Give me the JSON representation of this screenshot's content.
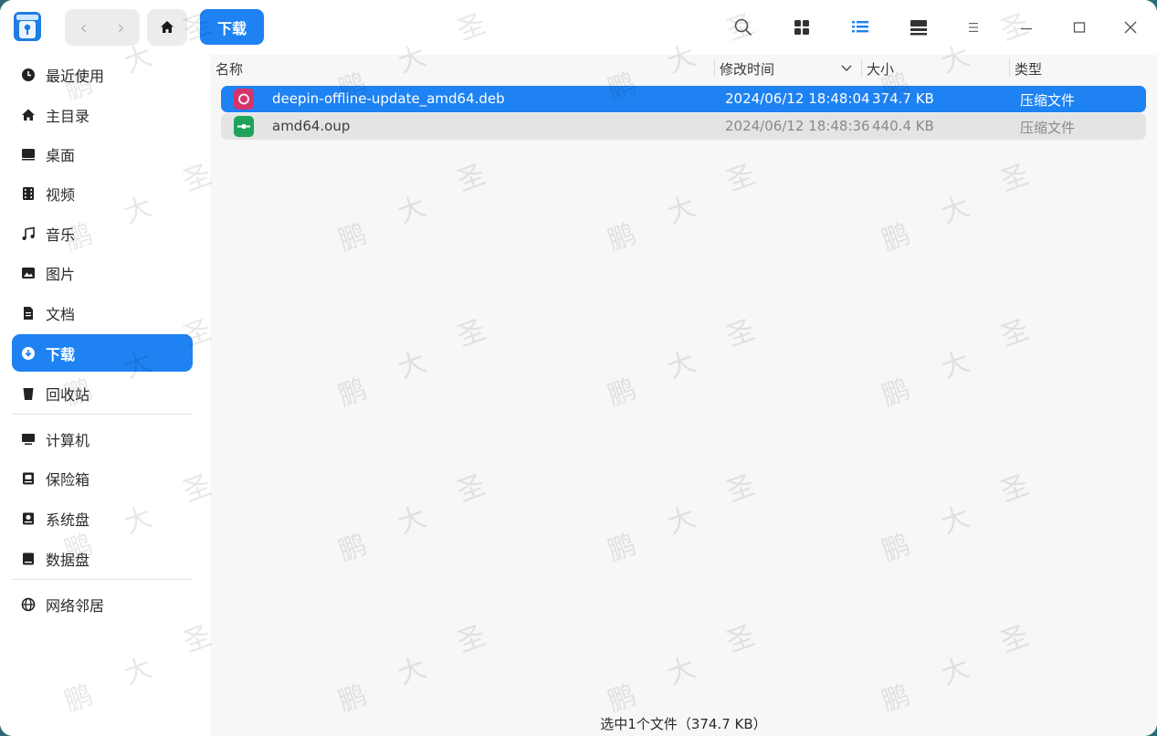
{
  "titlebar": {
    "breadcrumb": "下载",
    "icons": [
      "back-icon",
      "forward-icon",
      "home-icon",
      "search-icon",
      "icon-view-icon",
      "list-view-icon",
      "detail-view-icon",
      "menu-icon",
      "minimize-icon",
      "maximize-icon",
      "close-icon"
    ],
    "accent": "#1e82f2"
  },
  "sidebar": {
    "items": [
      {
        "label": "最近使用",
        "icon": "clock-icon"
      },
      {
        "label": "主目录",
        "icon": "home-icon"
      },
      {
        "label": "桌面",
        "icon": "desktop-icon"
      },
      {
        "label": "视频",
        "icon": "video-icon"
      },
      {
        "label": "音乐",
        "icon": "music-icon"
      },
      {
        "label": "图片",
        "icon": "picture-icon"
      },
      {
        "label": "文档",
        "icon": "document-icon"
      },
      {
        "label": "下载",
        "icon": "download-icon",
        "active": true
      },
      {
        "label": "回收站",
        "icon": "trash-icon"
      },
      {
        "label": "计算机",
        "icon": "computer-icon"
      },
      {
        "label": "保险箱",
        "icon": "vault-icon"
      },
      {
        "label": "系统盘",
        "icon": "system-disk-icon"
      },
      {
        "label": "数据盘",
        "icon": "data-disk-icon"
      },
      {
        "label": "网络邻居",
        "icon": "network-icon"
      }
    ]
  },
  "main": {
    "columns": {
      "name": "名称",
      "modified": "修改时间",
      "size": "大小",
      "type": "类型"
    },
    "files": [
      {
        "name": "deepin-offline-update_amd64.deb",
        "modified": "2024/06/12 18:48:04",
        "size": "374.7 KB",
        "type": "压缩文件",
        "icon": "deb-package-icon",
        "selected": true
      },
      {
        "name": "amd64.oup",
        "modified": "2024/06/12 18:48:36",
        "size": "440.4 KB",
        "type": "压缩文件",
        "icon": "archive-file-icon",
        "selected": false
      }
    ],
    "status": "选中1个文件（374.7 KB）"
  },
  "watermark": {
    "chars": [
      "鹏",
      "大",
      "圣"
    ]
  }
}
